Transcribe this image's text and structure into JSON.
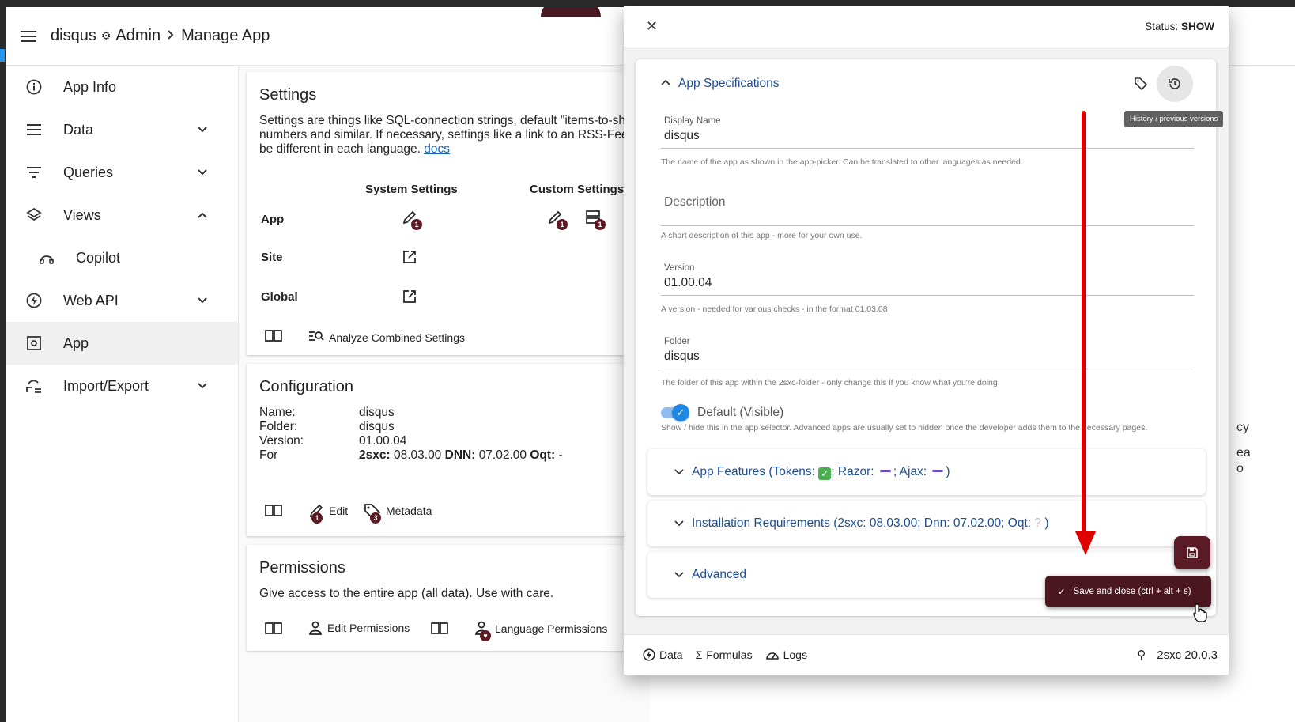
{
  "appbar": {
    "site": "disqus",
    "section": "Admin",
    "page": "Manage App"
  },
  "sidebar": {
    "items": [
      {
        "label": "App Info",
        "icon": "info-icon"
      },
      {
        "label": "Data",
        "icon": "list-icon"
      },
      {
        "label": "Queries",
        "icon": "filter-icon"
      },
      {
        "label": "Views",
        "icon": "layers-icon"
      },
      {
        "label": "Copilot",
        "icon": "copilot-icon"
      },
      {
        "label": "Web API",
        "icon": "bolt-icon"
      },
      {
        "label": "App",
        "icon": "app-icon"
      },
      {
        "label": "Import/Export",
        "icon": "import-export-icon"
      }
    ]
  },
  "settings": {
    "title": "Settings",
    "desc_line1": "Settings are things like SQL-connection strings, default \"items-to-show",
    "desc_line2": "numbers and similar. If necessary, settings like a link to an RSS-Feed c",
    "desc_line3": "be different in each language.",
    "docs_link": "docs",
    "col_system": "System Settings",
    "col_custom": "Custom Settings",
    "row_app": "App",
    "row_site": "Site",
    "row_global": "Global",
    "badge": "1",
    "analyze": "Analyze Combined Settings"
  },
  "configuration": {
    "title": "Configuration",
    "name_k": "Name:",
    "name_v": "disqus",
    "folder_k": "Folder:",
    "folder_v": "disqus",
    "version_k": "Version:",
    "version_v": "01.00.04",
    "for_k": "For",
    "sxc_k": "2sxc:",
    "sxc_v": "08.03.00",
    "dnn_k": "DNN:",
    "dnn_v": "07.02.00",
    "oqt_k": "Oqt:",
    "oqt_v": "-",
    "edit": "Edit",
    "edit_badge": "1",
    "metadata": "Metadata",
    "metadata_badge": "3"
  },
  "permissions": {
    "title": "Permissions",
    "desc": "Give access to the entire app (all data). Use with care.",
    "edit": "Edit Permissions",
    "language": "Language Permissions"
  },
  "dialog": {
    "status_label": "Status:",
    "status_value": "SHOW",
    "section_title": "App Specifications",
    "tooltip": "History / previous versions",
    "display_name_label": "Display Name",
    "display_name_value": "disqus",
    "display_name_hint": "The name of the app as shown in the app-picker. Can be translated to other languages as needed.",
    "description_placeholder": "Description",
    "description_hint": "A short description of this app - more for your own use.",
    "version_label": "Version",
    "version_value": "01.00.04",
    "version_hint": "A version - needed for various checks - in the format 01.03.08",
    "folder_label": "Folder",
    "folder_value": "disqus",
    "folder_hint": "The folder of this app within the 2sxc-folder - only change this if you know what you're doing.",
    "default_label": "Default (Visible)",
    "default_hint": "Show / hide this in the app selector. Advanced apps are usually set to hidden once the developer adds them to the necessary pages.",
    "features_prefix": "App Features (Tokens:",
    "features_razor": "; Razor:",
    "features_ajax": "; Ajax:",
    "features_suffix": ")",
    "install_req": "Installation Requirements (2sxc: 08.03.00; Dnn: 07.02.00; Oqt:",
    "install_suffix": ")",
    "advanced": "Advanced",
    "save_close": "Save and close (ctrl + alt + s)",
    "foot_data": "Data",
    "foot_formulas": "Formulas",
    "foot_logs": "Logs",
    "version_info": "2sxc 20.0.3"
  },
  "right_edge": {
    "a": "cy",
    "b": "ea",
    "c": "o"
  },
  "colors": {
    "brand_dark": "#5a1a26",
    "link_blue": "#1d4f91",
    "toggle_blue": "#1e88e5",
    "arrow_red": "#e00000"
  }
}
